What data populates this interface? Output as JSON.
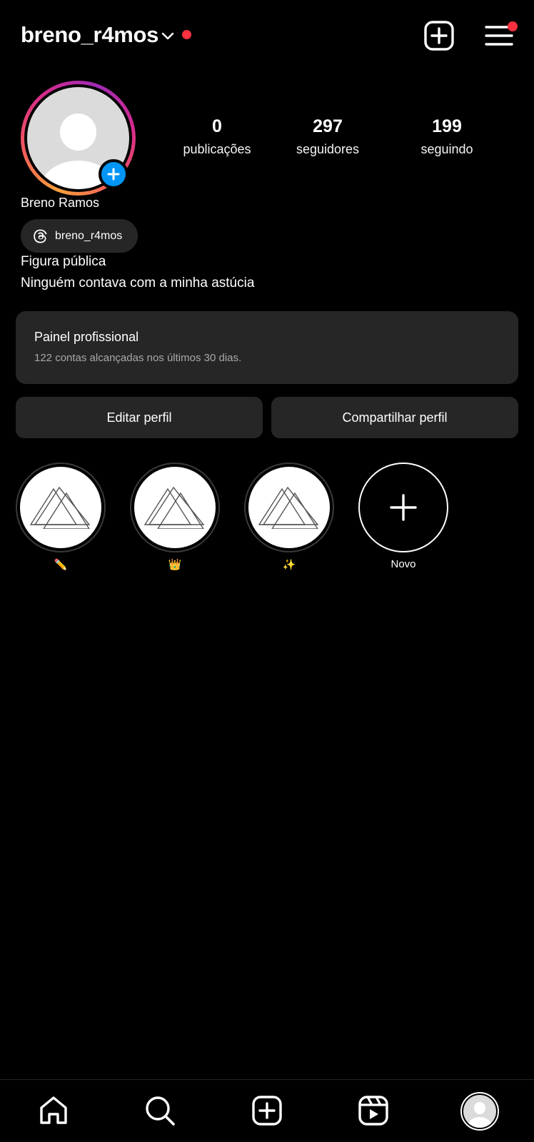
{
  "header": {
    "username": "breno_r4mos"
  },
  "profile": {
    "full_name": "Breno Ramos",
    "threads_handle": "breno_r4mos",
    "category": "Figura pública",
    "bio": "Ninguém contava com a minha astúcia",
    "stats": [
      {
        "value": "0",
        "label": "publicações"
      },
      {
        "value": "297",
        "label": "seguidores"
      },
      {
        "value": "199",
        "label": "seguindo"
      }
    ]
  },
  "pro_panel": {
    "title": "Painel profissional",
    "subtitle": "122 contas alcançadas nos últimos 30 dias."
  },
  "buttons": {
    "edit": "Editar perfil",
    "share": "Compartilhar perfil"
  },
  "highlights": [
    {
      "label": "✏️"
    },
    {
      "label": "👑"
    },
    {
      "label": "✨"
    },
    {
      "label": "Novo"
    }
  ],
  "colors": {
    "background": "#000000",
    "surface": "#262626",
    "accent_blue": "#0095f6",
    "notification_red": "#ff3040",
    "secondary_text": "#a8a8a8"
  },
  "nav": [
    "home-icon",
    "search-icon",
    "create-icon",
    "reels-icon",
    "profile-avatar"
  ]
}
